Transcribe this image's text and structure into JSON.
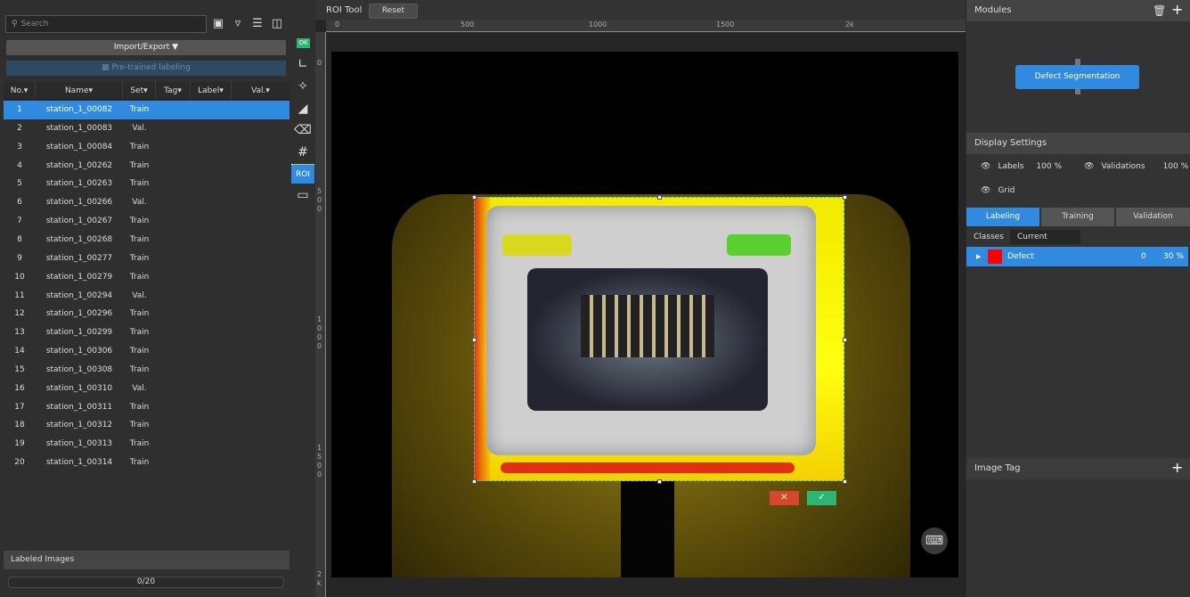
{
  "left": {
    "search_placeholder": "Search",
    "import_export": "Import/Export",
    "pretrained": "Pre-trained labeling",
    "columns": [
      "No.",
      "Name",
      "Set",
      "Tag",
      "Label",
      "Val."
    ],
    "rows": [
      {
        "no": "1",
        "name": "station_1_00082",
        "set": "Train"
      },
      {
        "no": "2",
        "name": "station_1_00083",
        "set": "Val."
      },
      {
        "no": "3",
        "name": "station_1_00084",
        "set": "Train"
      },
      {
        "no": "4",
        "name": "station_1_00262",
        "set": "Train"
      },
      {
        "no": "5",
        "name": "station_1_00263",
        "set": "Train"
      },
      {
        "no": "6",
        "name": "station_1_00266",
        "set": "Val."
      },
      {
        "no": "7",
        "name": "station_1_00267",
        "set": "Train"
      },
      {
        "no": "8",
        "name": "station_1_00268",
        "set": "Train"
      },
      {
        "no": "9",
        "name": "station_1_00277",
        "set": "Train"
      },
      {
        "no": "10",
        "name": "station_1_00279",
        "set": "Train"
      },
      {
        "no": "11",
        "name": "station_1_00294",
        "set": "Val."
      },
      {
        "no": "12",
        "name": "station_1_00296",
        "set": "Train"
      },
      {
        "no": "13",
        "name": "station_1_00299",
        "set": "Train"
      },
      {
        "no": "14",
        "name": "station_1_00306",
        "set": "Train"
      },
      {
        "no": "15",
        "name": "station_1_00308",
        "set": "Train"
      },
      {
        "no": "16",
        "name": "station_1_00310",
        "set": "Val."
      },
      {
        "no": "17",
        "name": "station_1_00311",
        "set": "Train"
      },
      {
        "no": "18",
        "name": "station_1_00312",
        "set": "Train"
      },
      {
        "no": "19",
        "name": "station_1_00313",
        "set": "Train"
      },
      {
        "no": "20",
        "name": "station_1_00314",
        "set": "Train"
      }
    ],
    "labeled_images": "Labeled Images",
    "progress": "0/20"
  },
  "toolbar": {
    "ok": "OK",
    "roi": "ROI"
  },
  "center": {
    "tool_title": "ROI Tool",
    "reset": "Reset",
    "hruler": [
      "0",
      "500",
      "1000",
      "1500",
      "2k"
    ],
    "vruler": [
      "0",
      "5\n0\n0",
      "1\n0\n0\n0",
      "1\n5\n0\n0",
      "2\nk"
    ]
  },
  "right": {
    "modules": "Modules",
    "module_node": "Defect Segmentation",
    "display_settings": "Display Settings",
    "labels": "Labels",
    "labels_pct": "100 %",
    "validations": "Validations",
    "validations_pct": "100 %",
    "grid": "Grid",
    "tabs": [
      "Labeling",
      "Training",
      "Validation"
    ],
    "classes": "Classes",
    "classes_filter": "Current image",
    "class": {
      "name": "Defect",
      "color": "#ff0000",
      "count": "0",
      "pct": "30 %"
    },
    "image_tag": "Image Tag"
  },
  "colors": {
    "accent": "#2f8ae0",
    "ok": "#2bb673",
    "cancel": "#d9472b"
  }
}
